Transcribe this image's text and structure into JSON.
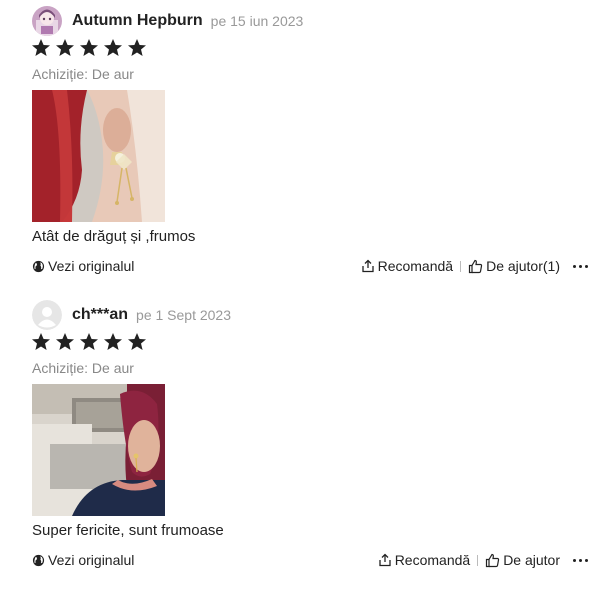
{
  "reviews": [
    {
      "username": "Autumn Hepburn",
      "date": "pe 15 iun 2023",
      "rating": 5,
      "purchase": "Achiziție: De aur",
      "text": "Atât de drăguț și ,frumos",
      "view_original": "Vezi originalul",
      "recommend": "Recomandă",
      "helpful": "De ajutor(1)",
      "avatar_icon": "anime-avatar-icon",
      "photo_desc": "earring-photo"
    },
    {
      "username": "ch***an",
      "date": "pe 1 Sept 2023",
      "rating": 5,
      "purchase": "Achiziție: De aur",
      "text": "Super fericite, sunt frumoase",
      "view_original": "Vezi originalul",
      "recommend": "Recomandă",
      "helpful": "De ajutor",
      "avatar_icon": "default-user-avatar-icon",
      "photo_desc": "wearing-earring-photo"
    }
  ],
  "colors": {
    "star": "#222222",
    "muted": "#999999",
    "text": "#222222"
  }
}
